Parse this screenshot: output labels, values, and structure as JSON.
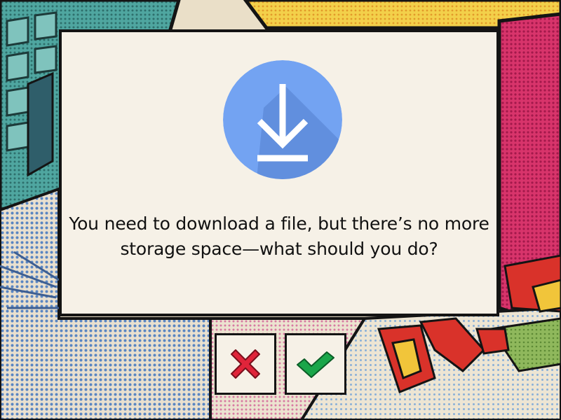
{
  "question": {
    "text": "You need to download a file, but there’s no more storage space—what should you do?"
  },
  "icon": {
    "name": "download-icon",
    "circle_color": "#73a3f2",
    "shadow_color": "#5f8ddc"
  },
  "answers": {
    "no": {
      "icon": "cross-icon",
      "color": "#e0243a"
    },
    "yes": {
      "icon": "check-icon",
      "color": "#1aa64a"
    }
  },
  "colors": {
    "card": "#f6f1e7",
    "border": "#141414"
  }
}
